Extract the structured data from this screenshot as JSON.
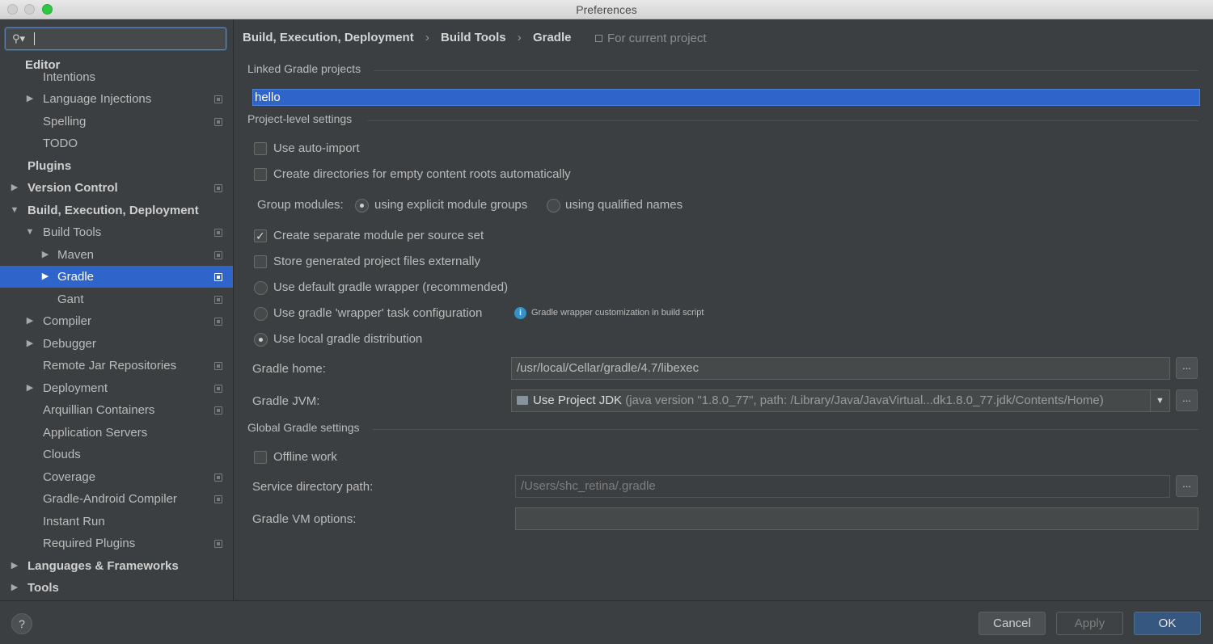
{
  "window": {
    "title": "Preferences"
  },
  "search": {
    "placeholder": ""
  },
  "sidebar": {
    "sticky_header": "Editor",
    "items": [
      {
        "label": "Intentions"
      },
      {
        "label": "Language Injections"
      },
      {
        "label": "Spelling"
      },
      {
        "label": "TODO"
      },
      {
        "label": "Plugins"
      },
      {
        "label": "Version Control"
      },
      {
        "label": "Build, Execution, Deployment"
      },
      {
        "label": "Build Tools"
      },
      {
        "label": "Maven"
      },
      {
        "label": "Gradle"
      },
      {
        "label": "Gant"
      },
      {
        "label": "Compiler"
      },
      {
        "label": "Debugger"
      },
      {
        "label": "Remote Jar Repositories"
      },
      {
        "label": "Deployment"
      },
      {
        "label": "Arquillian Containers"
      },
      {
        "label": "Application Servers"
      },
      {
        "label": "Clouds"
      },
      {
        "label": "Coverage"
      },
      {
        "label": "Gradle-Android Compiler"
      },
      {
        "label": "Instant Run"
      },
      {
        "label": "Required Plugins"
      },
      {
        "label": "Languages & Frameworks"
      },
      {
        "label": "Tools"
      }
    ],
    "selected": "Gradle"
  },
  "breadcrumb": {
    "items": [
      "Build, Execution, Deployment",
      "Build Tools",
      "Gradle"
    ],
    "separator": "›",
    "scope": "For current project"
  },
  "linked": {
    "section_title": "Linked Gradle projects",
    "projects": [
      "hello"
    ]
  },
  "project_settings": {
    "section_title": "Project-level settings",
    "auto_import": {
      "label": "Use auto-import",
      "checked": false
    },
    "create_dirs": {
      "label": "Create directories for empty content roots automatically",
      "checked": false
    },
    "group_modules": {
      "label": "Group modules:",
      "options": [
        "using explicit module groups",
        "using qualified names"
      ],
      "selected": "using explicit module groups"
    },
    "separate_module": {
      "label": "Create separate module per source set",
      "checked": true
    },
    "store_external": {
      "label": "Store generated project files externally",
      "checked": false
    },
    "distribution": {
      "options": [
        "Use default gradle wrapper (recommended)",
        "Use gradle 'wrapper' task configuration",
        "Use local gradle distribution"
      ],
      "selected": "Use local gradle distribution",
      "wrapper_hint": "Gradle wrapper customization in build script"
    },
    "gradle_home": {
      "label": "Gradle home:",
      "value": "/usr/local/Cellar/gradle/4.7/libexec"
    },
    "gradle_jvm": {
      "label": "Gradle JVM:",
      "value_main": "Use Project JDK",
      "value_detail": "(java version \"1.8.0_77\", path: /Library/Java/JavaVirtual...dk1.8.0_77.jdk/Contents/Home)"
    },
    "browse_label": "..."
  },
  "global_settings": {
    "section_title": "Global Gradle settings",
    "offline": {
      "label": "Offline work",
      "checked": false
    },
    "service_dir": {
      "label": "Service directory path:",
      "placeholder": "/Users/shc_retina/.gradle"
    },
    "vm_options": {
      "label": "Gradle VM options:",
      "value": ""
    }
  },
  "footer": {
    "help": "?",
    "cancel": "Cancel",
    "apply": "Apply",
    "ok": "OK"
  },
  "colors": {
    "selection": "#2f65ca",
    "background": "#3c3f41",
    "primary_button": "#365880"
  }
}
